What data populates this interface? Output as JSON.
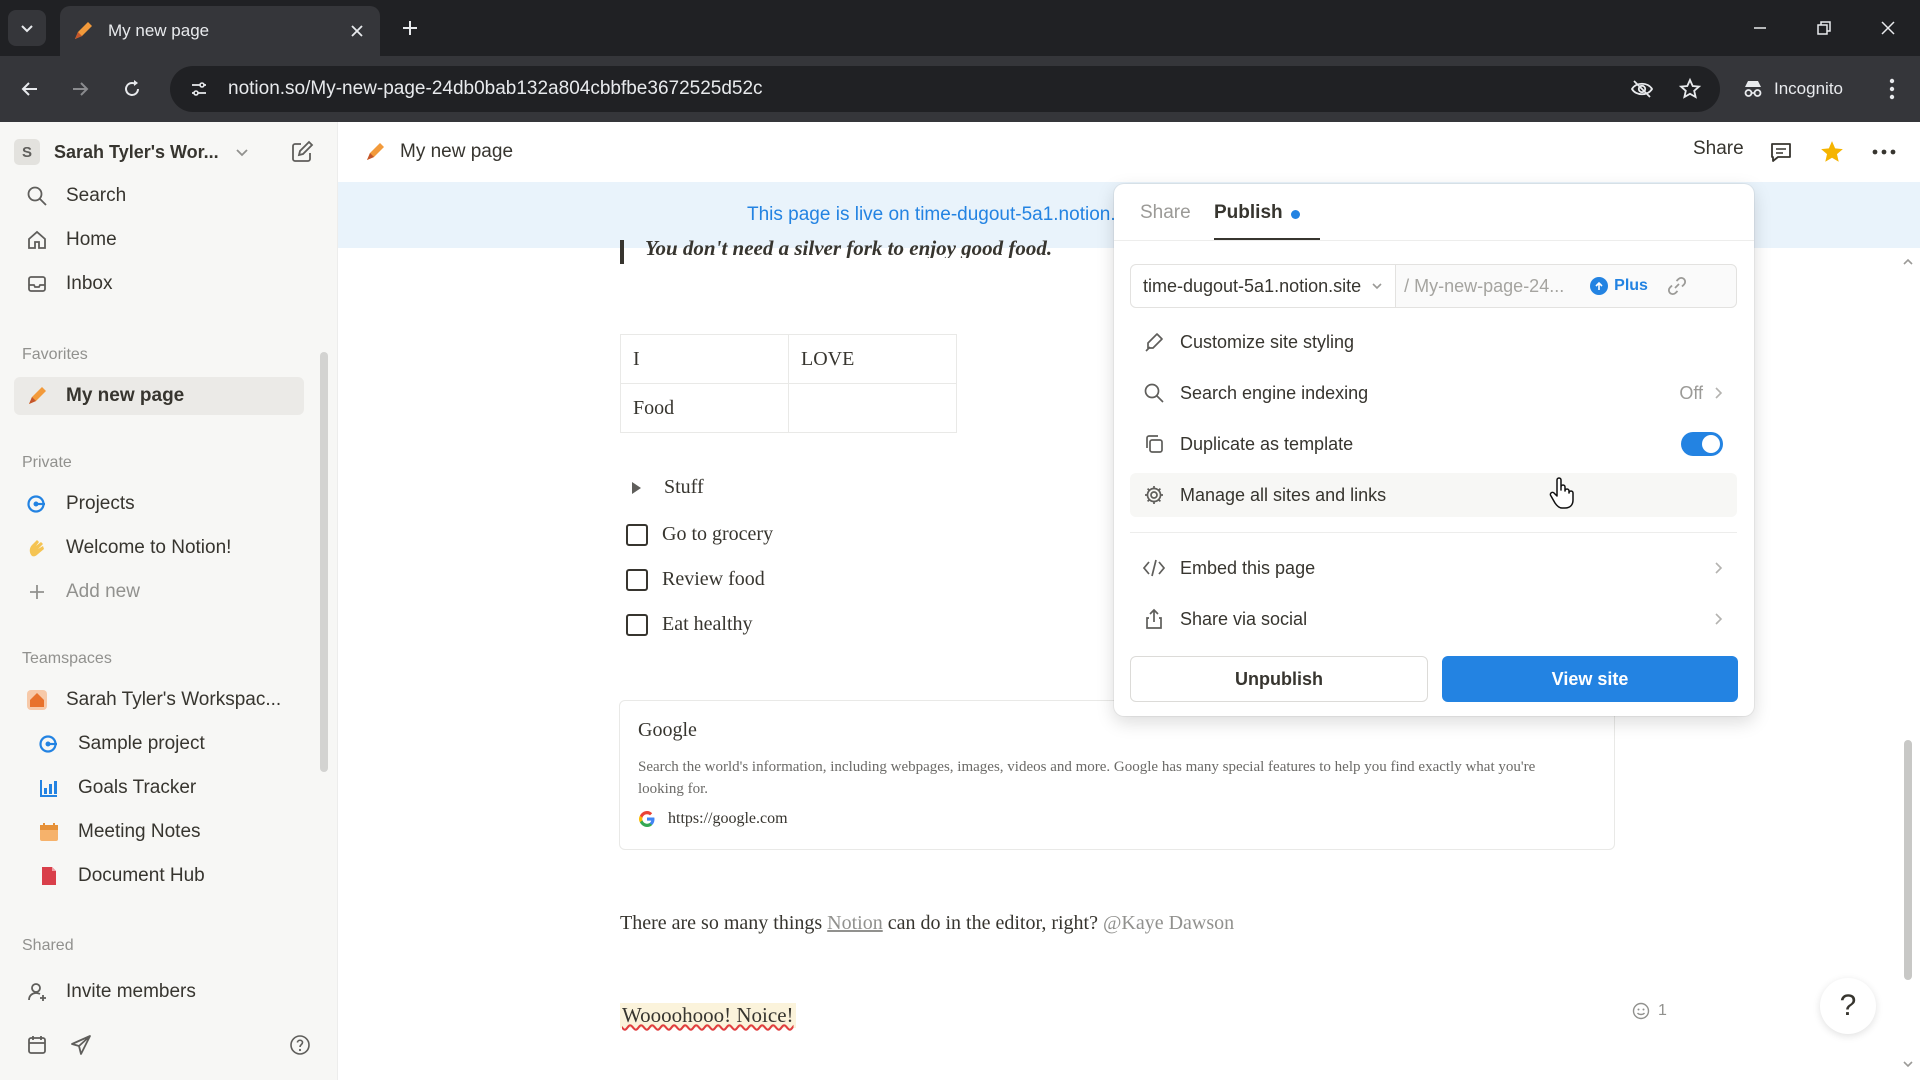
{
  "browser": {
    "tab_title": "My new page",
    "url": "notion.so/My-new-page-24db0bab132a804cbbfbe3672525d52c",
    "incognito_label": "Incognito"
  },
  "sidebar": {
    "workspace_initial": "S",
    "workspace_name": "Sarah Tyler's Wor...",
    "nav": [
      {
        "label": "Search",
        "icon": "search-icon"
      },
      {
        "label": "Home",
        "icon": "home-icon"
      },
      {
        "label": "Inbox",
        "icon": "inbox-icon"
      }
    ],
    "favorites_heading": "Favorites",
    "favorites": [
      {
        "label": "My new page",
        "icon": "pencil-icon"
      }
    ],
    "private_heading": "Private",
    "private": [
      {
        "label": "Projects",
        "icon": "projects-icon"
      },
      {
        "label": "Welcome to Notion!",
        "icon": "wave-icon"
      },
      {
        "label": "Add new",
        "icon": "plus-icon"
      }
    ],
    "teamspaces_heading": "Teamspaces",
    "teamspaces": [
      {
        "label": "Sarah Tyler's Workspac...",
        "icon": "house-icon"
      },
      {
        "label": "Sample project",
        "icon": "projects-icon"
      },
      {
        "label": "Goals Tracker",
        "icon": "chart-icon"
      },
      {
        "label": "Meeting Notes",
        "icon": "calendar-icon"
      },
      {
        "label": "Document Hub",
        "icon": "document-icon"
      }
    ],
    "shared_heading": "Shared",
    "invite_label": "Invite members"
  },
  "topbar": {
    "breadcrumb": "My new page",
    "share_label": "Share"
  },
  "banner": {
    "text": "This page is live on time-dugout-5a1.notion.site"
  },
  "page": {
    "quote": "You don't need a silver fork to enjoy good food.",
    "table": [
      [
        "I",
        "LOVE"
      ],
      [
        "Food",
        ""
      ]
    ],
    "toggle_label": "Stuff",
    "todos": [
      "Go to grocery",
      "Review food",
      "Eat healthy"
    ],
    "bookmark": {
      "title": "Google",
      "description": "Search the world's information, including webpages, images, videos and more. Google has many special features to help you find exactly what you're looking for.",
      "url": "https://google.com"
    },
    "paragraph_pre": "There are so many things ",
    "paragraph_link": "Notion",
    "paragraph_mid": " can do in the editor, right? ",
    "paragraph_mention": "@Kaye Dawson",
    "noice": "Woooohooo! Noice!",
    "reaction_count": "1",
    "help_glyph": "?"
  },
  "publish_popover": {
    "tabs": [
      "Share",
      "Publish"
    ],
    "active_tab": "Publish",
    "domain": "time-dugout-5a1.notion.site",
    "path": "/ My-new-page-24...",
    "plus_label": "Plus",
    "items": [
      {
        "label": "Customize site styling",
        "icon": "brush-icon"
      },
      {
        "label": "Search engine indexing",
        "icon": "search-icon",
        "value": "Off"
      },
      {
        "label": "Duplicate as template",
        "icon": "duplicate-icon",
        "toggle": true
      },
      {
        "label": "Manage all sites and links",
        "icon": "gear-icon"
      },
      {
        "label": "Embed this page",
        "icon": "code-icon"
      },
      {
        "label": "Share via social",
        "icon": "share-icon"
      }
    ],
    "unpublish_label": "Unpublish",
    "view_site_label": "View site"
  },
  "colors": {
    "accent": "#2383e2",
    "banner_bg": "#e9f3fb",
    "sidebar_bg": "#f7f7f5"
  }
}
